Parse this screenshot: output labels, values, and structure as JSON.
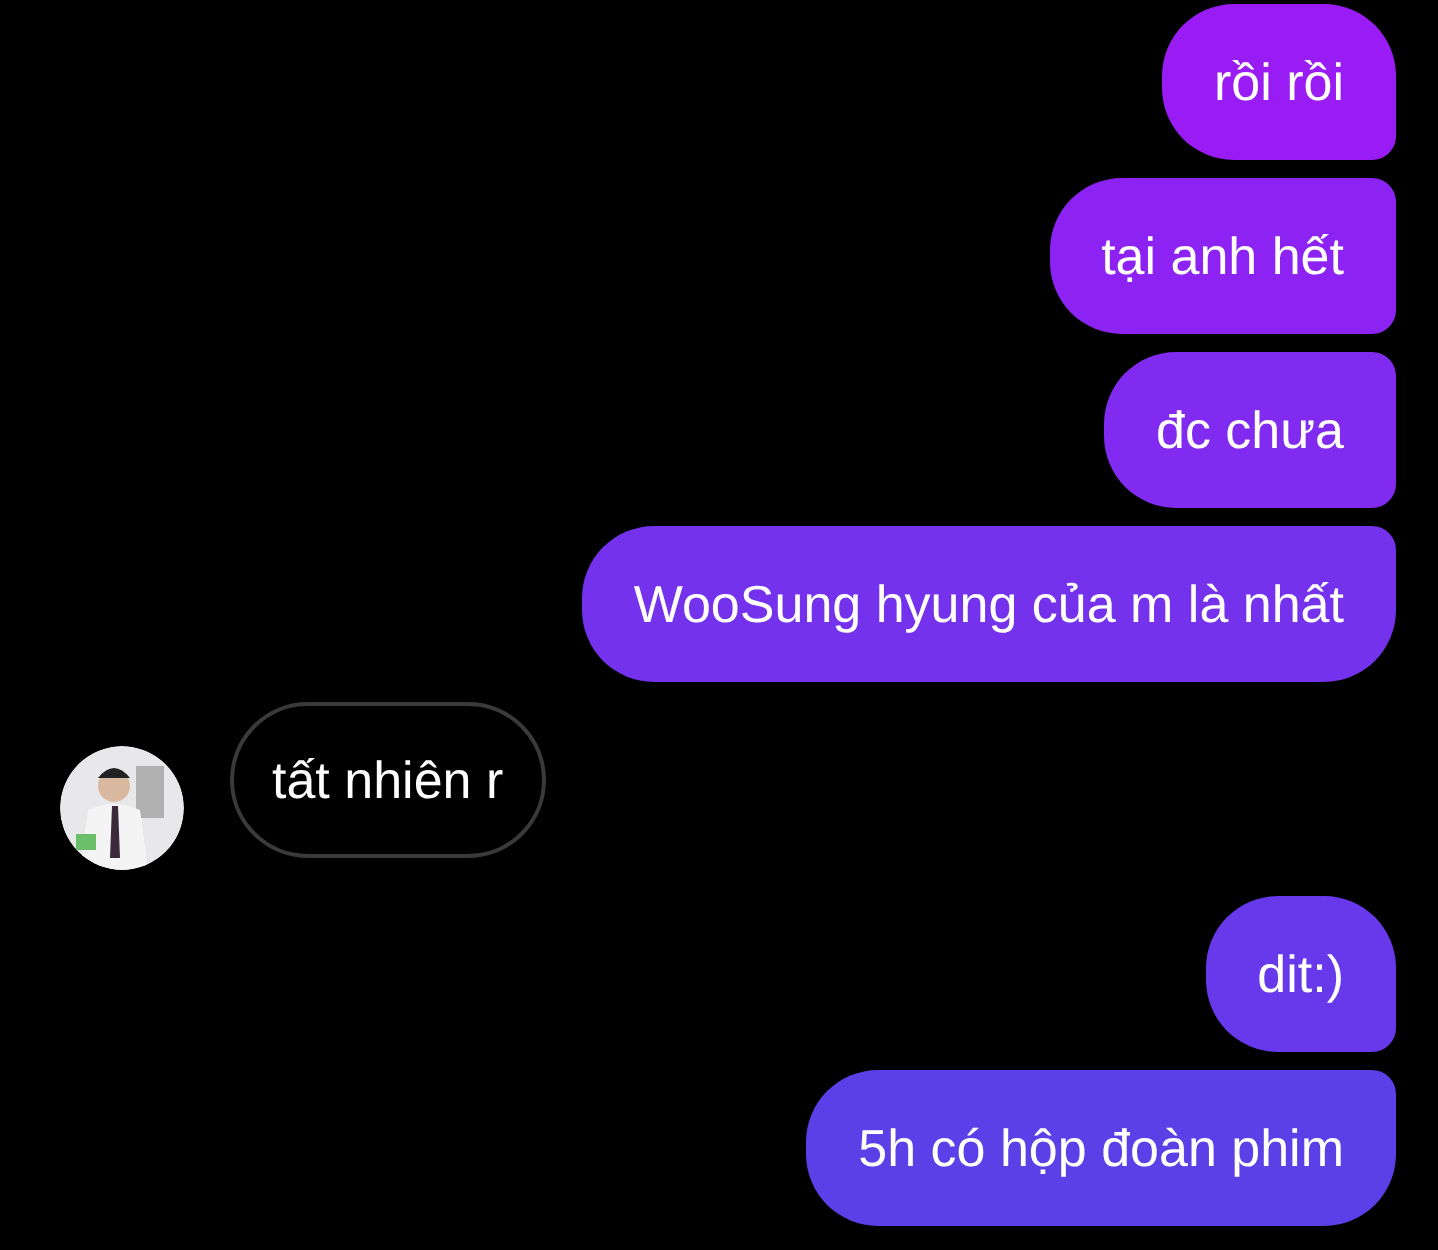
{
  "messages": [
    {
      "kind": "outgoing",
      "text": "rồi rồi"
    },
    {
      "kind": "outgoing",
      "text": "tại anh hết"
    },
    {
      "kind": "outgoing",
      "text": "đc chưa"
    },
    {
      "kind": "outgoing",
      "text": "WooSung hyung của m là nhất"
    },
    {
      "kind": "incoming",
      "text": "tất nhiên r"
    },
    {
      "kind": "outgoing",
      "text": "dit:)"
    },
    {
      "kind": "outgoing",
      "text": "5h có hộp đoàn phim"
    }
  ]
}
